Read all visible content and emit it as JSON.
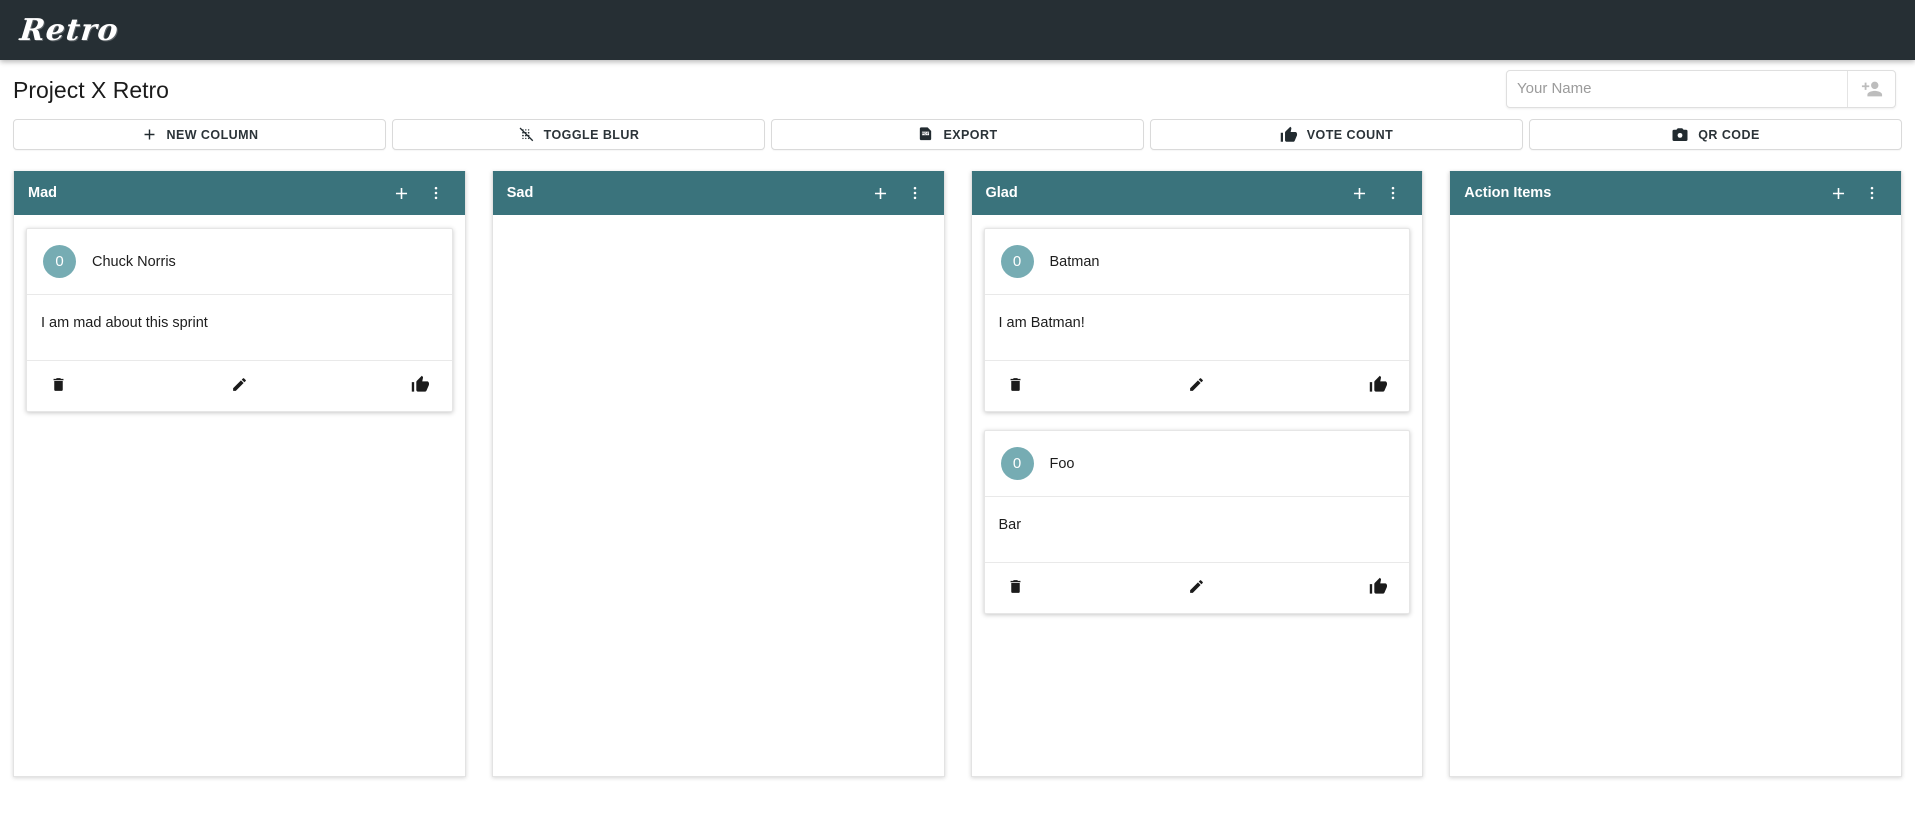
{
  "appbar": {
    "logo": "Retro"
  },
  "header": {
    "page_title": "Project X Retro",
    "name_input": {
      "value": "",
      "placeholder": "Your Name"
    },
    "add_user_icon": "person-add-icon"
  },
  "toolbar": {
    "buttons": [
      {
        "label": "NEW COLUMN",
        "icon": "plus-icon"
      },
      {
        "label": "TOGGLE BLUR",
        "icon": "blur-off-icon"
      },
      {
        "label": "EXPORT",
        "icon": "pdf-icon"
      },
      {
        "label": "VOTE COUNT",
        "icon": "thumb-up-icon"
      },
      {
        "label": "QR CODE",
        "icon": "camera-icon"
      }
    ]
  },
  "colors": {
    "appbar_bg": "#262f34",
    "column_header_bg": "#3a737c",
    "avatar_bg": "#76acb3",
    "page_bg": "#ffffff"
  },
  "board": {
    "add_icon": "plus-icon",
    "menu_icon": "more-vertical-icon",
    "card_icons": {
      "delete": "trash-icon",
      "edit": "pencil-icon",
      "vote": "thumb-up-icon"
    },
    "columns": [
      {
        "title": "Mad",
        "cards": [
          {
            "votes": "0",
            "author": "Chuck Norris",
            "text": "I am mad about this sprint"
          }
        ]
      },
      {
        "title": "Sad",
        "cards": []
      },
      {
        "title": "Glad",
        "cards": [
          {
            "votes": "0",
            "author": "Batman",
            "text": "I am Batman!"
          },
          {
            "votes": "0",
            "author": "Foo",
            "text": "Bar"
          }
        ]
      },
      {
        "title": "Action Items",
        "cards": []
      }
    ]
  }
}
